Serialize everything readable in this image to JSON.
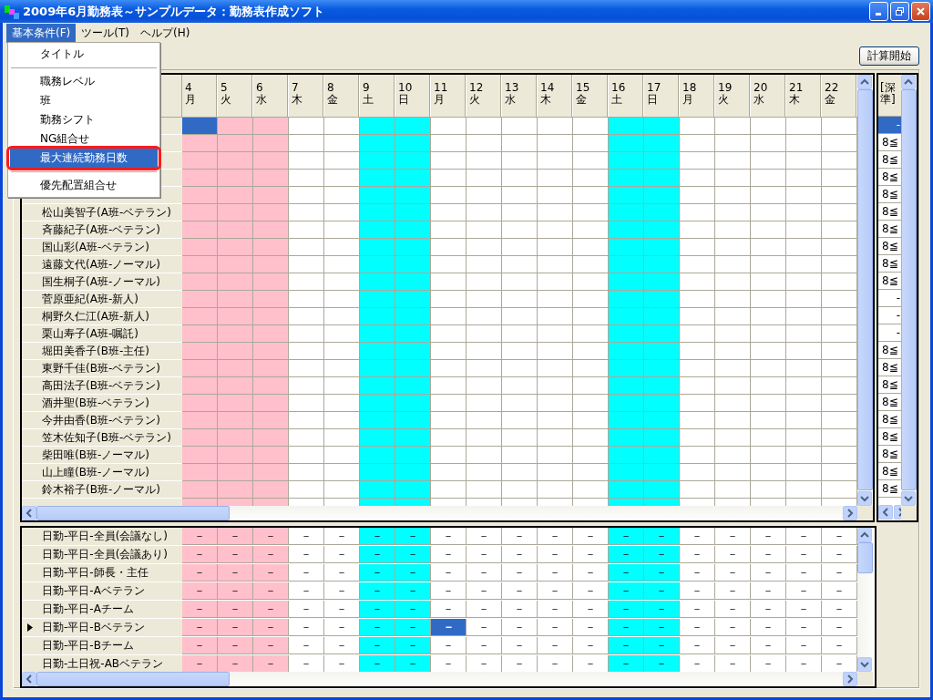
{
  "window": {
    "title": "2009年6月勤務表～サンプルデータ：勤務表作成ソフト"
  },
  "menu_bar": [
    {
      "label": "基本条件(F)",
      "selected": true
    },
    {
      "label": "ツール(T)",
      "selected": false
    },
    {
      "label": "ヘルプ(H)",
      "selected": false
    }
  ],
  "open_menu": [
    {
      "kind": "item",
      "label": "タイトル",
      "selected": false,
      "circled": false
    },
    {
      "kind": "separator"
    },
    {
      "kind": "item",
      "label": "職務レベル",
      "selected": false,
      "circled": false
    },
    {
      "kind": "item",
      "label": "班",
      "selected": false,
      "circled": false
    },
    {
      "kind": "item",
      "label": "勤務シフト",
      "selected": false,
      "circled": false
    },
    {
      "kind": "item",
      "label": "NG組合せ",
      "selected": false,
      "circled": false
    },
    {
      "kind": "item",
      "label": "最大連続勤務日数",
      "selected": true,
      "circled": true
    },
    {
      "kind": "separator"
    },
    {
      "kind": "item",
      "label": "優先配置組合せ",
      "selected": false,
      "circled": false
    }
  ],
  "toolbar": {
    "start_button": "計算開始"
  },
  "top_grid": {
    "days": [
      {
        "date": "4",
        "weekday": "月",
        "color": "#ffc0cb",
        "selected": true
      },
      {
        "date": "5",
        "weekday": "火",
        "color": "#ffc0cb",
        "selected": false
      },
      {
        "date": "6",
        "weekday": "水",
        "color": "#ffc0cb",
        "selected": false
      },
      {
        "date": "7",
        "weekday": "木",
        "color": "#ffffff",
        "selected": false
      },
      {
        "date": "8",
        "weekday": "金",
        "color": "#ffffff",
        "selected": false
      },
      {
        "date": "9",
        "weekday": "土",
        "color": "#00ffff",
        "selected": false
      },
      {
        "date": "10",
        "weekday": "日",
        "color": "#00ffff",
        "selected": false
      },
      {
        "date": "11",
        "weekday": "月",
        "color": "#ffffff",
        "selected": false
      },
      {
        "date": "12",
        "weekday": "火",
        "color": "#ffffff",
        "selected": false
      },
      {
        "date": "13",
        "weekday": "水",
        "color": "#ffffff",
        "selected": false
      },
      {
        "date": "14",
        "weekday": "木",
        "color": "#ffffff",
        "selected": false
      },
      {
        "date": "15",
        "weekday": "金",
        "color": "#ffffff",
        "selected": false
      },
      {
        "date": "16",
        "weekday": "土",
        "color": "#00ffff",
        "selected": false
      },
      {
        "date": "17",
        "weekday": "日",
        "color": "#00ffff",
        "selected": false
      },
      {
        "date": "18",
        "weekday": "月",
        "color": "#ffffff",
        "selected": false
      },
      {
        "date": "19",
        "weekday": "火",
        "color": "#ffffff",
        "selected": false
      },
      {
        "date": "20",
        "weekday": "水",
        "color": "#ffffff",
        "selected": false
      },
      {
        "date": "21",
        "weekday": "木",
        "color": "#ffffff",
        "selected": false
      },
      {
        "date": "22",
        "weekday": "金",
        "color": "#ffffff",
        "selected": false
      }
    ],
    "side_header": [
      "[深",
      "準]"
    ],
    "rows": [
      {
        "selected": true,
        "limit": "-"
      },
      {
        "selected": false,
        "limit": "8≦"
      },
      {
        "selected": false,
        "limit": "8≦"
      },
      {
        "selected": false,
        "limit": "8≦"
      },
      {
        "selected": false,
        "limit": "8≦"
      },
      {
        "name": "松山美智子(A班-ベテラン)",
        "selected": false,
        "limit": "8≦"
      },
      {
        "name": "斉藤紀子(A班-ベテラン)",
        "selected": false,
        "limit": "8≦"
      },
      {
        "name": "国山彩(A班-ベテラン)",
        "selected": false,
        "limit": "8≦"
      },
      {
        "name": "遠藤文代(A班-ノーマル)",
        "selected": false,
        "limit": "8≦"
      },
      {
        "name": "国生桐子(A班-ノーマル)",
        "selected": false,
        "limit": "8≦"
      },
      {
        "name": "菅原亜紀(A班-新人)",
        "selected": false,
        "limit": "-"
      },
      {
        "name": "桐野久仁江(A班-新人)",
        "selected": false,
        "limit": "-"
      },
      {
        "name": "栗山寿子(A班-嘱託)",
        "selected": false,
        "limit": "-"
      },
      {
        "name": "堀田美香子(B班-主任)",
        "selected": false,
        "limit": "8≦"
      },
      {
        "name": "東野千佳(B班-ベテラン)",
        "selected": false,
        "limit": "8≦"
      },
      {
        "name": "高田法子(B班-ベテラン)",
        "selected": false,
        "limit": "8≦"
      },
      {
        "name": "酒井聖(B班-ベテラン)",
        "selected": false,
        "limit": "8≦"
      },
      {
        "name": "今井由香(B班-ベテラン)",
        "selected": false,
        "limit": "8≦"
      },
      {
        "name": "笠木佐知子(B班-ベテラン)",
        "selected": false,
        "limit": "8≦"
      },
      {
        "name": "柴田唯(B班-ノーマル)",
        "selected": false,
        "limit": "8≦"
      },
      {
        "name": "山上瞳(B班-ノーマル)",
        "selected": false,
        "limit": "8≦"
      },
      {
        "name": "鈴木裕子(B班-ノーマル)",
        "selected": false,
        "limit": "8≦"
      }
    ]
  },
  "bottom_grid": {
    "columns": [
      {
        "color": "#ffc0cb",
        "selected": false
      },
      {
        "color": "#ffc0cb",
        "selected": false
      },
      {
        "color": "#ffc0cb",
        "selected": false
      },
      {
        "color": "#ffffff",
        "selected": false
      },
      {
        "color": "#ffffff",
        "selected": false
      },
      {
        "color": "#00ffff",
        "selected": false
      },
      {
        "color": "#00ffff",
        "selected": false
      },
      {
        "color": "#ffffff",
        "selected": true
      },
      {
        "color": "#ffffff",
        "selected": false
      },
      {
        "color": "#ffffff",
        "selected": false
      },
      {
        "color": "#ffffff",
        "selected": false
      },
      {
        "color": "#ffffff",
        "selected": false
      },
      {
        "color": "#00ffff",
        "selected": false
      },
      {
        "color": "#00ffff",
        "selected": false
      },
      {
        "color": "#ffffff",
        "selected": false
      },
      {
        "color": "#ffffff",
        "selected": false
      },
      {
        "color": "#ffffff",
        "selected": false
      },
      {
        "color": "#ffffff",
        "selected": false
      },
      {
        "color": "#ffffff",
        "selected": false
      }
    ],
    "rows": [
      {
        "name": "日勤-平日-全員(会議なし)",
        "selected": false,
        "cells": [
          "－",
          "－",
          "－",
          "－",
          "－",
          "－",
          "－",
          "－",
          "－",
          "－",
          "－",
          "－",
          "－",
          "－",
          "－",
          "－",
          "－",
          "－",
          "－"
        ]
      },
      {
        "name": "日勤-平日-全員(会議あり)",
        "selected": false,
        "cells": [
          "－",
          "－",
          "－",
          "－",
          "－",
          "－",
          "－",
          "－",
          "－",
          "－",
          "－",
          "－",
          "－",
          "－",
          "－",
          "－",
          "－",
          "－",
          "－"
        ]
      },
      {
        "name": "日勤-平日-師長・主任",
        "selected": false,
        "cells": [
          "－",
          "－",
          "－",
          "－",
          "－",
          "－",
          "－",
          "－",
          "－",
          "－",
          "－",
          "－",
          "－",
          "－",
          "－",
          "－",
          "－",
          "－",
          "－"
        ]
      },
      {
        "name": "日勤-平日-Aベテラン",
        "selected": false,
        "cells": [
          "－",
          "－",
          "－",
          "－",
          "－",
          "－",
          "－",
          "－",
          "－",
          "－",
          "－",
          "－",
          "－",
          "－",
          "－",
          "－",
          "－",
          "－",
          "－"
        ]
      },
      {
        "name": "日勤-平日-Aチーム",
        "selected": false,
        "cells": [
          "－",
          "－",
          "－",
          "－",
          "－",
          "－",
          "－",
          "－",
          "－",
          "－",
          "－",
          "－",
          "－",
          "－",
          "－",
          "－",
          "－",
          "－",
          "－"
        ]
      },
      {
        "name": "日勤-平日-Bベテラン",
        "selected": true,
        "cells": [
          "－",
          "－",
          "－",
          "－",
          "－",
          "－",
          "－",
          "－",
          "－",
          "－",
          "－",
          "－",
          "－",
          "－",
          "－",
          "－",
          "－",
          "－",
          "－"
        ]
      },
      {
        "name": "日勤-平日-Bチーム",
        "selected": false,
        "cells": [
          "－",
          "－",
          "－",
          "－",
          "－",
          "－",
          "－",
          "－",
          "－",
          "－",
          "－",
          "－",
          "－",
          "－",
          "－",
          "－",
          "－",
          "－",
          "－"
        ]
      },
      {
        "name": "日勤-土日祝-ABベテラン",
        "selected": false,
        "cells": [
          "－",
          "－",
          "－",
          "－",
          "－",
          "－",
          "－",
          "－",
          "－",
          "－",
          "－",
          "－",
          "－",
          "－",
          "－",
          "－",
          "－",
          "－",
          "－"
        ]
      }
    ]
  }
}
